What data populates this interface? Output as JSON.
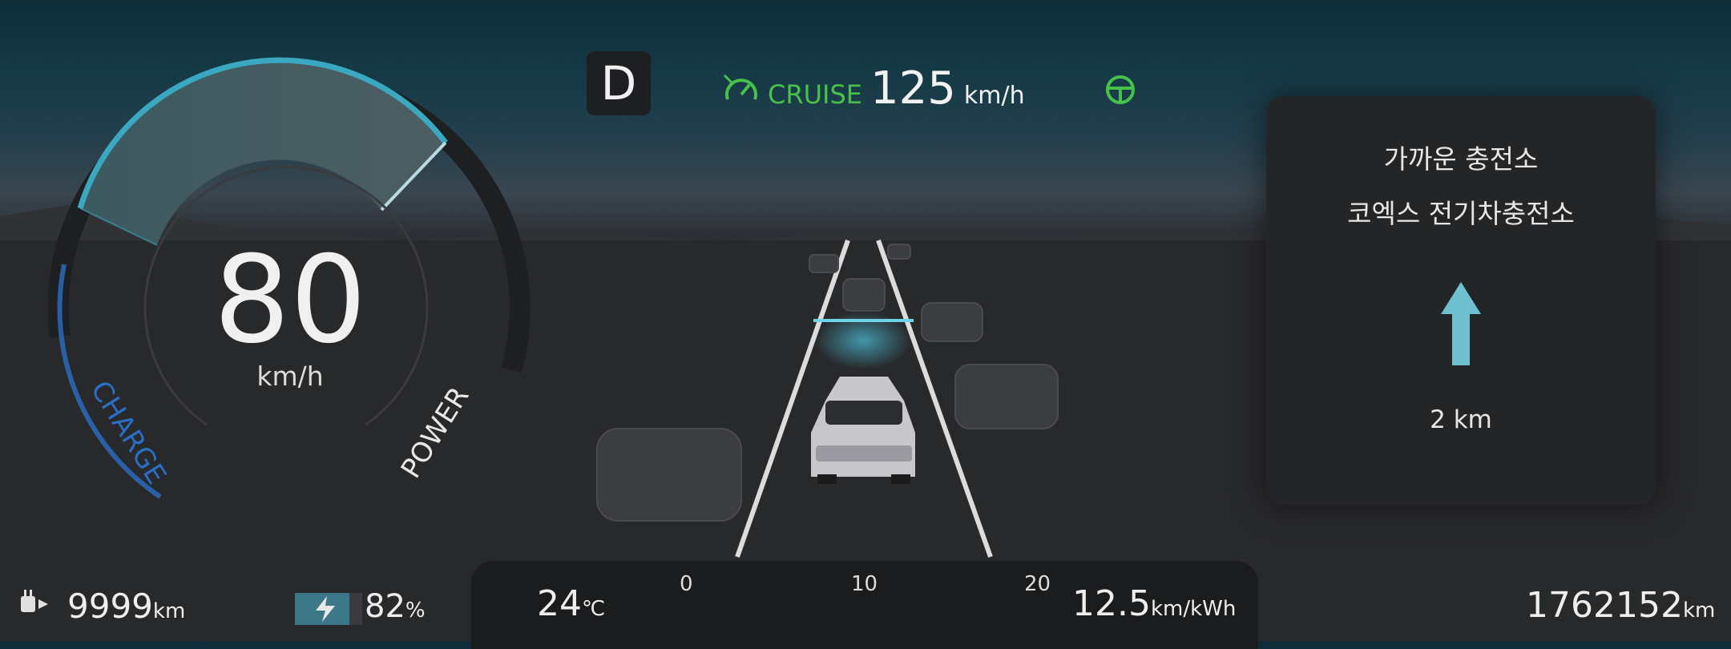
{
  "drive": {
    "gear": "D"
  },
  "cruise": {
    "label": "CRUISE",
    "speed": "125",
    "unit": "km/h",
    "color": "#46c24a"
  },
  "gauge": {
    "speed": "80",
    "unit": "km/h",
    "charge_label": "CHARGE",
    "power_label": "POWER"
  },
  "nav": {
    "title": "가까운 충전소",
    "station": "코엑스 전기차충전소",
    "distance": "2 km",
    "direction": "straight-arrow-icon"
  },
  "range": {
    "value": "9999",
    "unit": "km",
    "icon": "ev-plug-icon"
  },
  "battery": {
    "percent": "82",
    "unit": "%",
    "level": 0.82,
    "icon": "battery-bolt-icon"
  },
  "temperature": {
    "value": "24",
    "unit": "℃"
  },
  "consumption": {
    "scale": [
      "0",
      "10",
      "20"
    ],
    "value": 12.5,
    "marker": 0.24
  },
  "efficiency": {
    "value": "12.5",
    "unit": "km/kWh"
  },
  "odometer": {
    "value": "1762152",
    "unit": "km"
  },
  "colors": {
    "accent": "#3aa8c0",
    "cruise_green": "#46c24a",
    "charge_blue": "#2a6ec8"
  }
}
